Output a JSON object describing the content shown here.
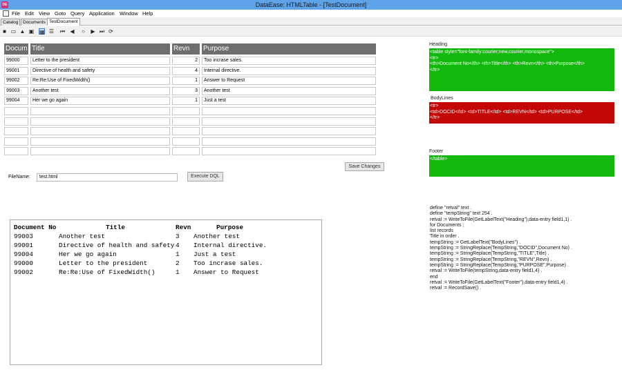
{
  "window": {
    "title": "DataEase: HTMLTable - [TestDocument]",
    "icon": "app-icon"
  },
  "menu": [
    "File",
    "Edit",
    "View",
    "Goto",
    "Query",
    "Application",
    "Window",
    "Help"
  ],
  "tabs": [
    "Catalog",
    "Documents",
    "TestDocument"
  ],
  "toolbar_icons": [
    "save-icon",
    "delete-icon",
    "stamp-icon",
    "print-icon",
    "form-view-icon",
    "table-view-icon",
    "first-record-icon",
    "previous-record-icon",
    "search-icon",
    "next-record-icon",
    "last-record-icon",
    "refresh-icon"
  ],
  "grid": {
    "headers": [
      "Docum",
      "Title",
      "Revn",
      "Purpose"
    ],
    "rows": [
      [
        "99000",
        "Letter to the president",
        "2",
        "Too incrase sales."
      ],
      [
        "99001",
        "Directive of health and safety",
        "4",
        "Internal directive."
      ],
      [
        "99002",
        "Re:Re:Use of FixedWidth()",
        "1",
        "Answer to Request"
      ],
      [
        "99003",
        "Another test",
        "3",
        "Another test"
      ],
      [
        "99004",
        "Her we go again",
        "1",
        "Just a test"
      ]
    ],
    "empty_rows": 5
  },
  "buttons": {
    "save_changes": "Save Changes",
    "execute_dql": "Execute DQL"
  },
  "filename": {
    "label": "FileName:",
    "value": "test.html"
  },
  "output": {
    "headers": [
      "Document No",
      "Title",
      "Revn",
      "Purpose"
    ],
    "rows": [
      [
        "99003",
        "Another test",
        "3",
        "Another test"
      ],
      [
        "99001",
        "Directive of health and safety",
        "4",
        "Internal directive."
      ],
      [
        "99004",
        "Her we go again",
        "1",
        "Just a test"
      ],
      [
        "99000",
        "Letter to the president",
        "2",
        "Too incrase sales."
      ],
      [
        "99002",
        "Re:Re:Use of FixedWidth()",
        "1",
        "Answer to Request"
      ]
    ]
  },
  "heading": {
    "label": "Heading",
    "lines": [
      "<table style=\"font-family:courier;new,courier,monospace\">",
      "<tr>",
      "<th>Document No</th> <th>Title</th> <th>Revn</th> <th>Purpose</th>",
      "</tr>"
    ]
  },
  "bodylines": {
    "label": "BodyLines",
    "lines": [
      "<tr>",
      "<td>DOCID</td> <td>TITLE</td> <td>REVN</td> <td>PURPOSE</td>",
      "</tr>"
    ]
  },
  "footer": {
    "label": "Footer",
    "lines": [
      "</table>"
    ]
  },
  "script": [
    "define \"retval\" text .",
    "define \"tempString\" text 254 .",
    "retval := WriteToFile(GetLabelText(\"Heading\"),data-entry field1,1) .",
    "for Documents ;",
    "list records",
    "Title in order .",
    "tempString := GetLabelText(\"BodyLines\") .",
    "tempString := StringReplace(TempString,\"DOCID\",Document No) .",
    "tempString := StringReplace(TempString,\"TITLE\",Title) .",
    "tempString := StringReplace(TempString,\"REVN\",Revn) .",
    "tempString := StringReplace(TempString,\"PURPOSE\",Purpose) .",
    "retval := WriteToFile(tempString,data-entry field1,4) .",
    "end",
    "retval := WriteToFile(GetLabelText(\"Footer\"),data-entry field1,4) .",
    "retval := RecordSave() ."
  ],
  "colors": {
    "titlebar": "#5ea3e8",
    "green": "#12b80c",
    "red": "#c30606",
    "grid_header": "#6e6e6e"
  }
}
